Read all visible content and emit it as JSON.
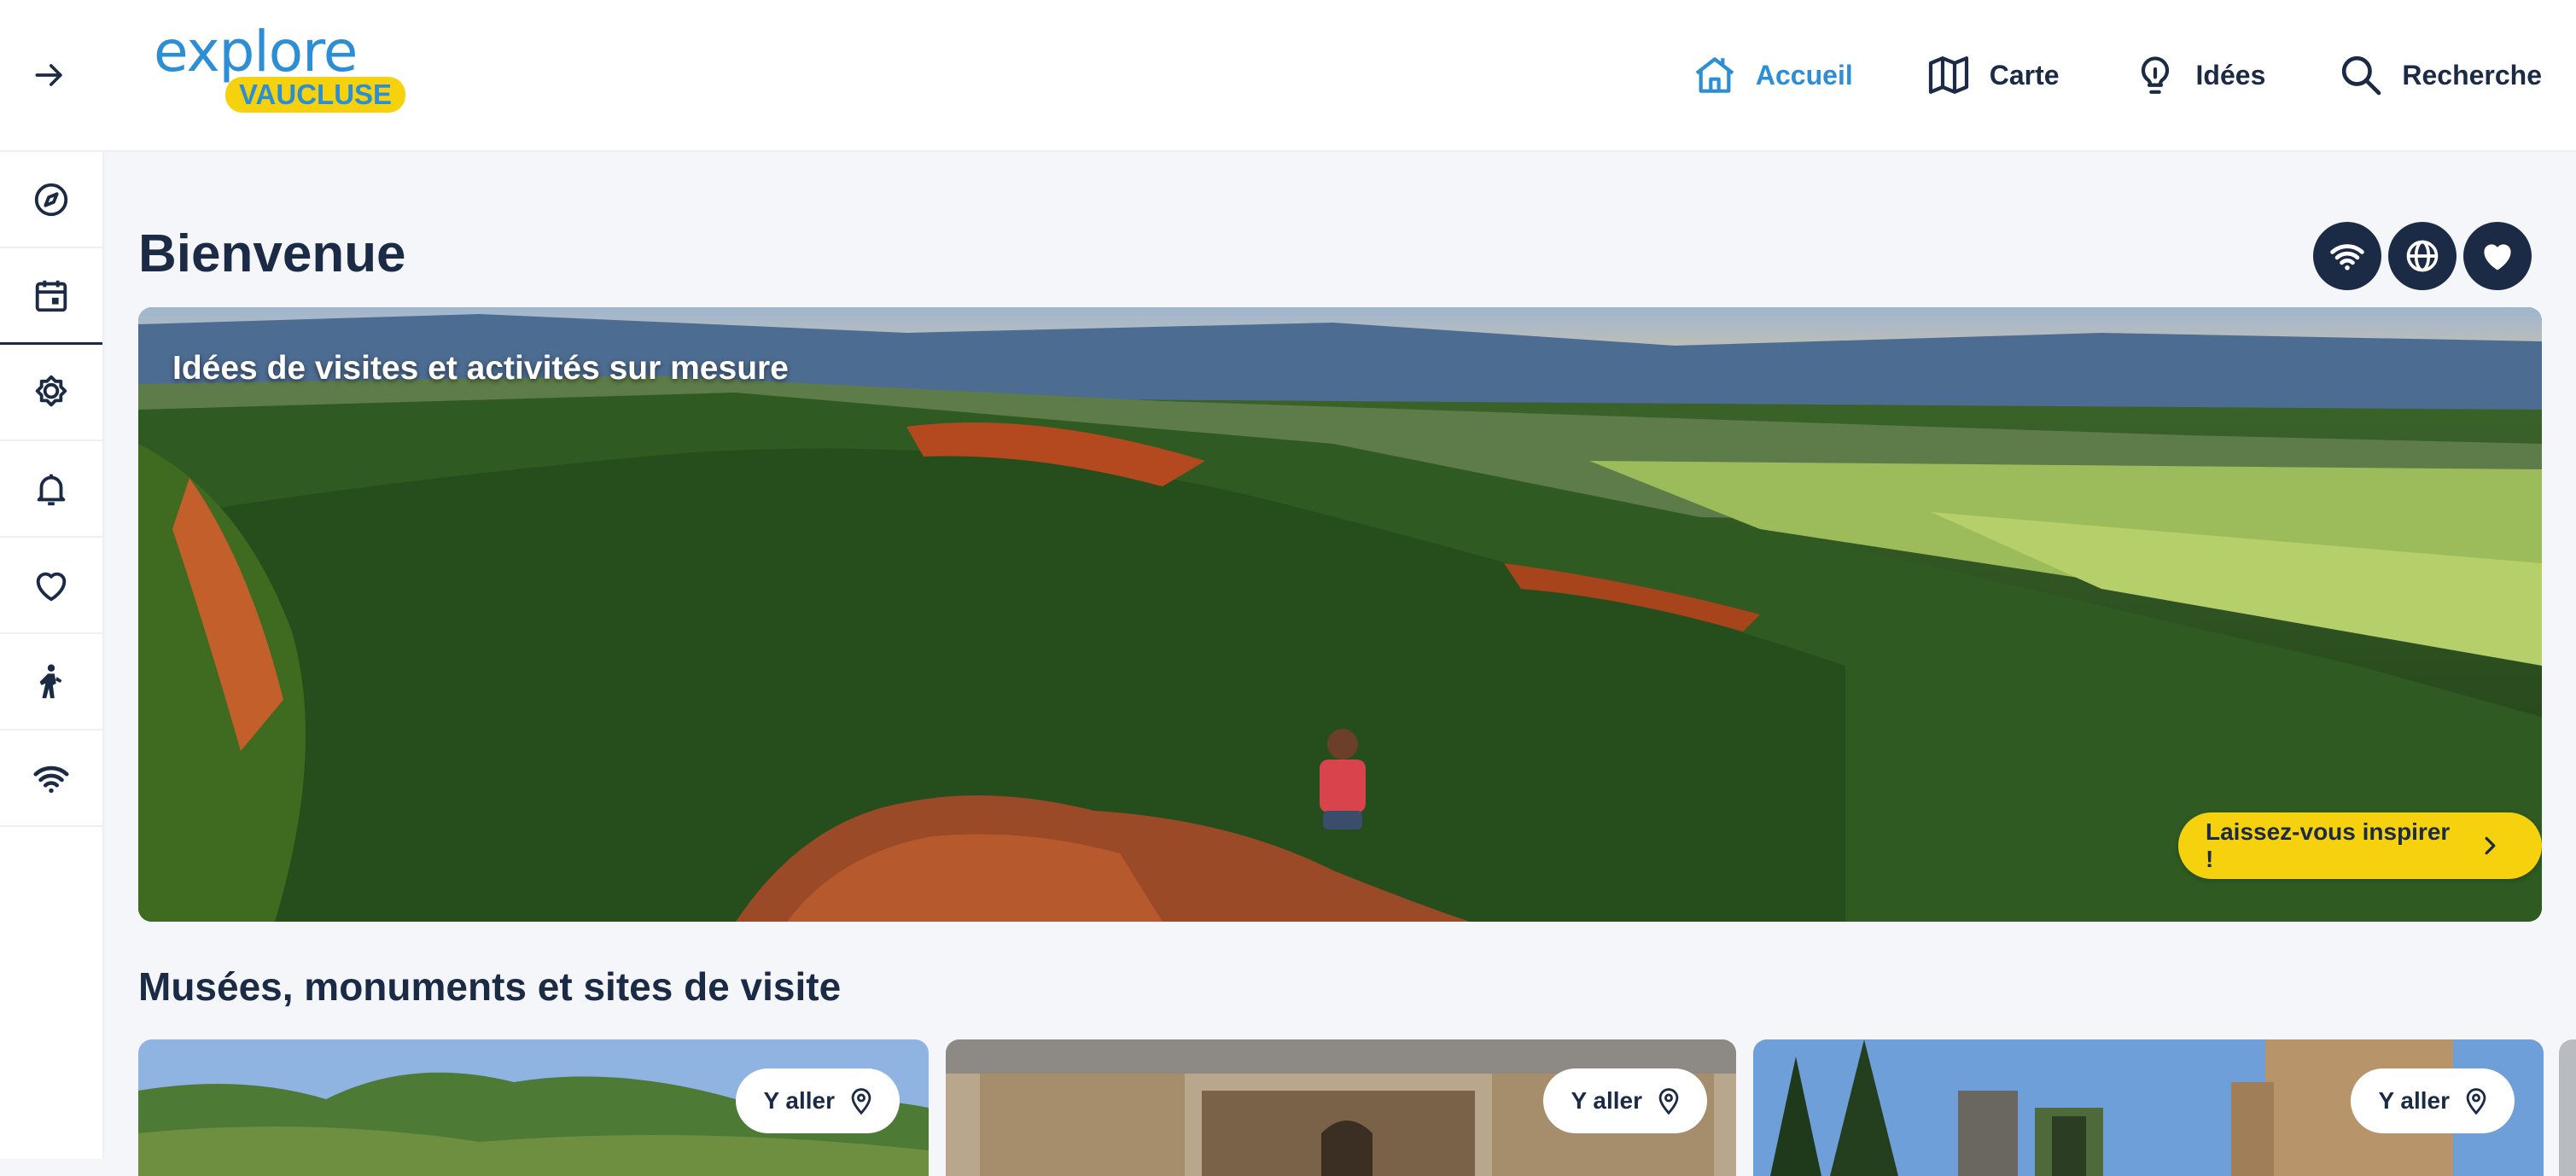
{
  "header": {
    "logo": {
      "line1": "explore",
      "line2": "VAUCLUSE"
    },
    "expand_icon": "arrow-right-icon",
    "nav": [
      {
        "label": "Accueil",
        "icon": "home-icon",
        "active": true
      },
      {
        "label": "Carte",
        "icon": "map-icon",
        "active": false
      },
      {
        "label": "Idées",
        "icon": "lightbulb-icon",
        "active": false
      },
      {
        "label": "Recherche",
        "icon": "search-icon",
        "active": false
      }
    ]
  },
  "sidebar": {
    "items": [
      {
        "icon": "compass-icon"
      },
      {
        "icon": "calendar-icon",
        "active": true
      },
      {
        "icon": "sun-icon"
      },
      {
        "icon": "bell-icon"
      },
      {
        "icon": "heart-icon"
      },
      {
        "icon": "hiker-icon"
      },
      {
        "icon": "wifi-icon"
      }
    ]
  },
  "main": {
    "title": "Bienvenue",
    "actions": [
      {
        "icon": "wifi-icon"
      },
      {
        "icon": "globe-icon"
      },
      {
        "icon": "heart-icon"
      }
    ],
    "hero": {
      "caption": "Idées de visites et activités sur mesure",
      "cta": "Laissez-vous inspirer !"
    },
    "section": {
      "title": "Musées, monuments et sites de visite",
      "cards": [
        {
          "button": "Y aller"
        },
        {
          "button": "Y aller"
        },
        {
          "button": "Y aller"
        }
      ]
    }
  },
  "colors": {
    "primary": "#1b2a45",
    "accent": "#2c8fd6",
    "yellow": "#f6d10d",
    "background": "#f4f6f9"
  }
}
